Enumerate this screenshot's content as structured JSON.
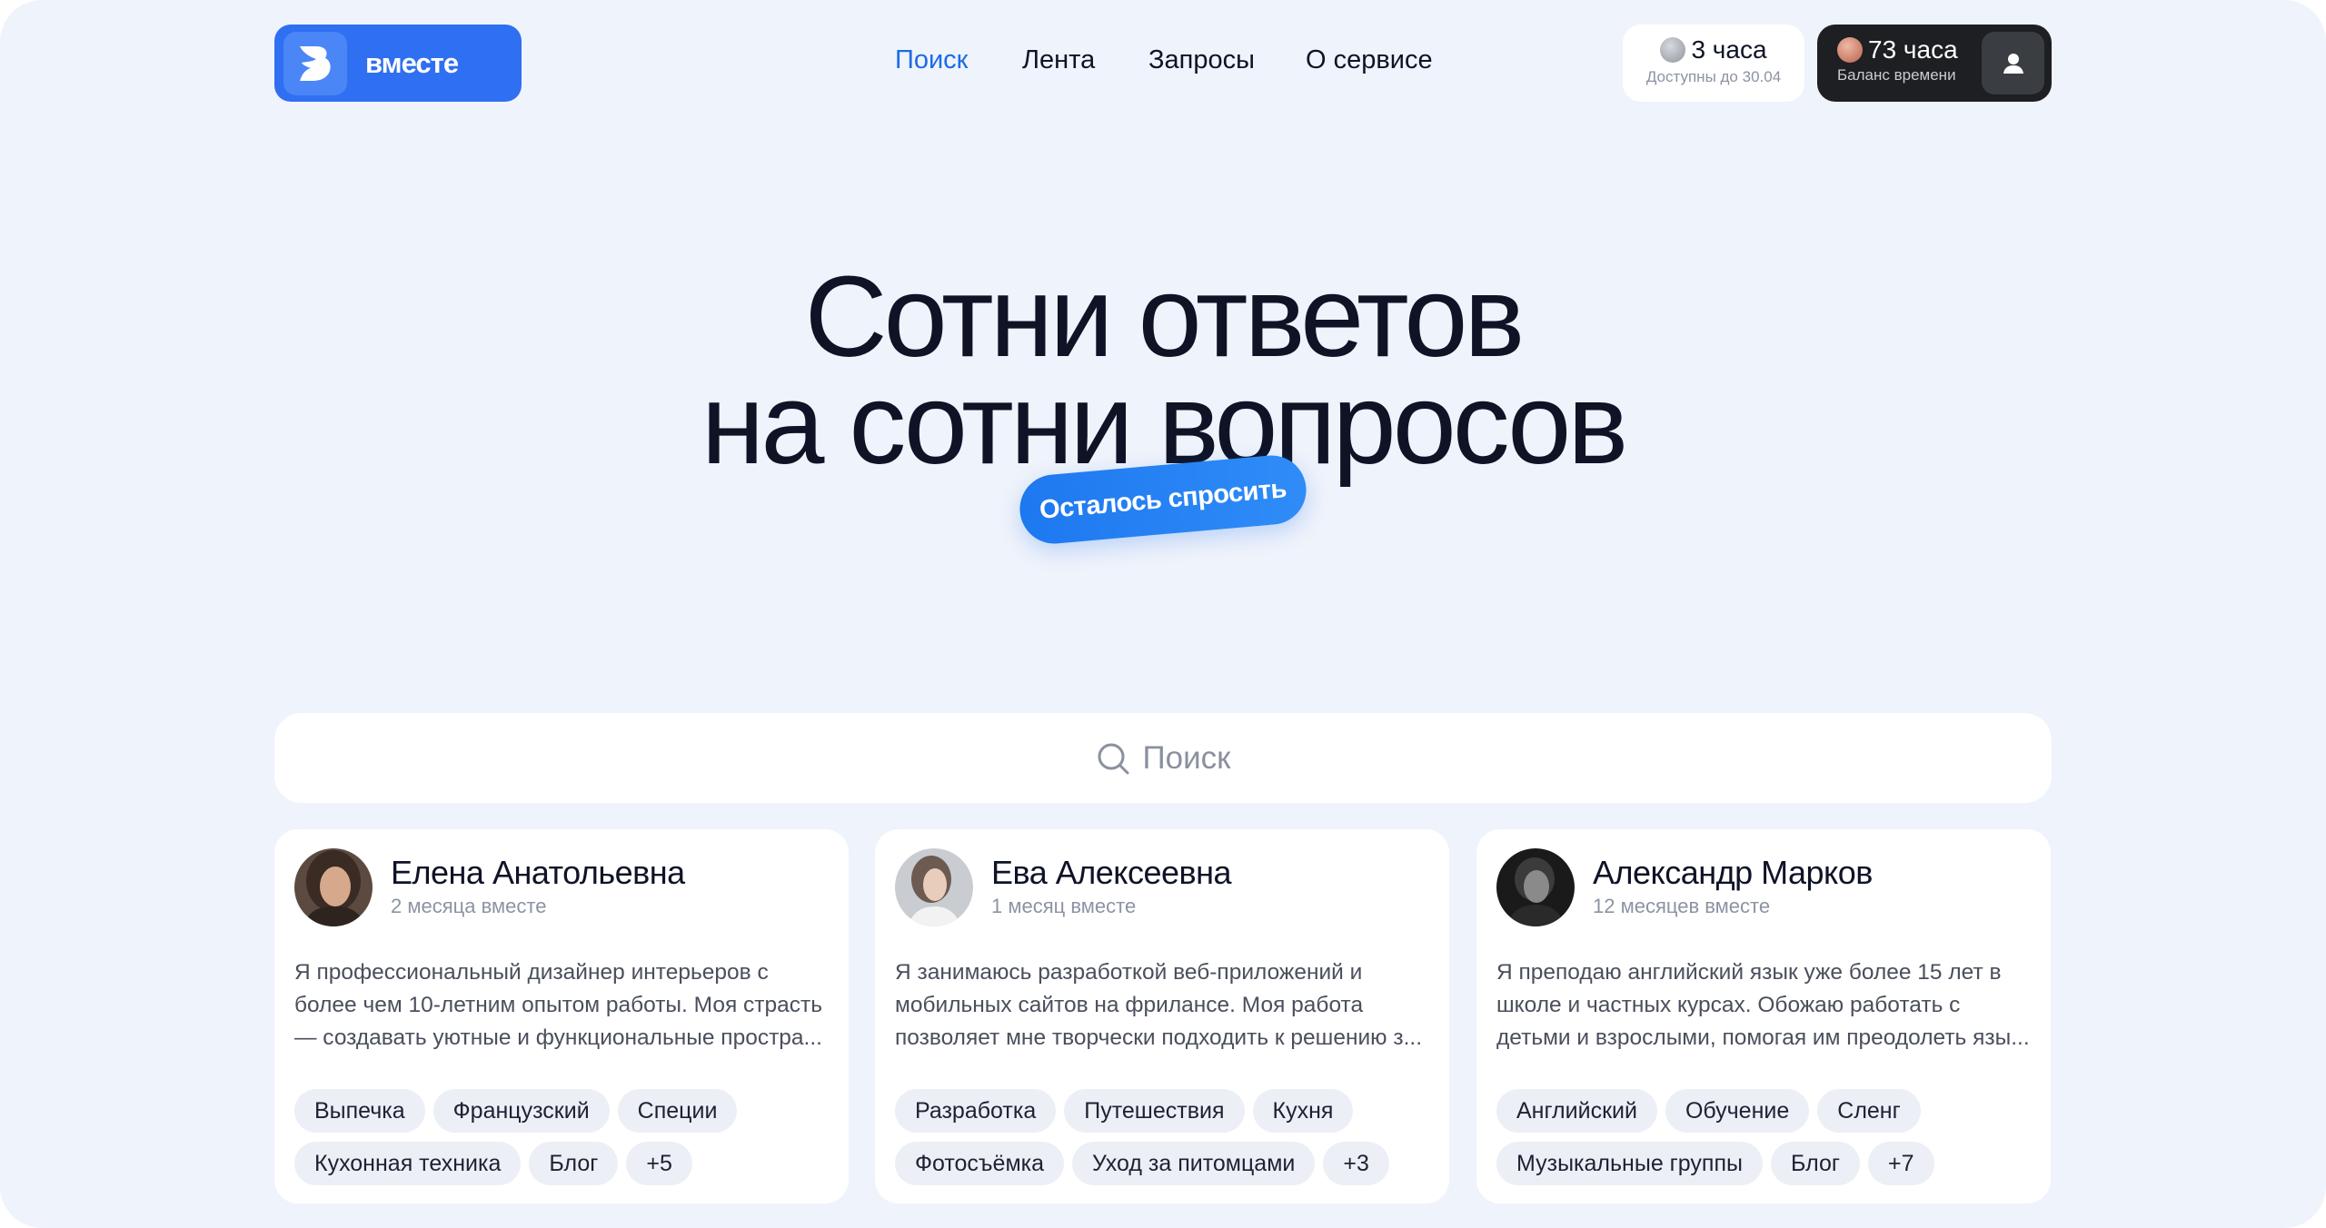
{
  "brand": {
    "name": "вместе",
    "accent": "#2f6ff2"
  },
  "nav": {
    "items": [
      {
        "label": "Поиск",
        "active": true
      },
      {
        "label": "Лента",
        "active": false
      },
      {
        "label": "Запросы",
        "active": false
      },
      {
        "label": "О сервисе",
        "active": false
      }
    ]
  },
  "free_hours": {
    "value": "3 часа",
    "caption": "Доступны до 30.04"
  },
  "balance": {
    "value": "73 часа",
    "caption": "Баланс времени"
  },
  "hero": {
    "line1": "Сотни ответов",
    "line2": "на сотни вопросов",
    "sticker": "Осталось спросить"
  },
  "search": {
    "placeholder": "Поиск"
  },
  "cards": [
    {
      "name": "Елена Анатольевна",
      "since": "2 месяца вместе",
      "text": [
        "Я профессиональный дизайнер интерьеров с",
        "более чем 10-летним опытом работы. Моя страсть",
        "— создавать уютные и функциональные простра..."
      ],
      "tags": [
        "Выпечка",
        "Французский",
        "Специи",
        "Кухонная техника",
        "Блог",
        "+5"
      ]
    },
    {
      "name": "Ева Алексеевна",
      "since": "1 месяц вместе",
      "text": [
        "Я занимаюсь разработкой веб-приложений и",
        "мобильных сайтов на фрилансе. Моя работа",
        "позволяет мне творчески подходить к решению з..."
      ],
      "tags": [
        "Разработка",
        "Путешествия",
        "Кухня",
        "Фотосъёмка",
        "Уход за питомцами",
        "+3"
      ]
    },
    {
      "name": "Александр Марков",
      "since": "12 месяцев вместе",
      "text": [
        "Я преподаю английский язык уже более 15 лет в",
        "школе и частных курсах. Обожаю работать с",
        "детьми и взрослыми, помогая им преодолеть язы..."
      ],
      "tags": [
        "Английский",
        "Обучение",
        "Сленг",
        "Музыкальные группы",
        "Блог",
        "+7"
      ]
    }
  ]
}
